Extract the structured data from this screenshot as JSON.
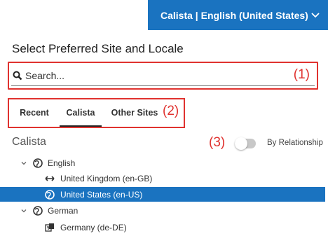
{
  "header": {
    "site_button_label": "Calista | English (United States)",
    "chevron_icon": "chevron-down-icon"
  },
  "panel": {
    "title": "Select Preferred Site and Locale",
    "search": {
      "placeholder": "Search...",
      "value": ""
    },
    "callouts": {
      "search": "(1)",
      "tabs": "(2)",
      "toggle": "(3)"
    },
    "tabs": [
      {
        "label": "Recent"
      },
      {
        "label": "Calista",
        "active": true
      },
      {
        "label": "Other Sites"
      }
    ],
    "section_title": "Calista",
    "toggle": {
      "label": "By Relationship",
      "on": false
    },
    "tree": [
      {
        "label": "English",
        "icon": "globe-icon",
        "expanded": true
      },
      {
        "label": "United Kingdom (en-GB)",
        "icon": "bidirectional-arrow-icon"
      },
      {
        "label": "United States (en-US)",
        "icon": "globe-icon",
        "selected": true
      },
      {
        "label": "German",
        "icon": "globe-icon",
        "expanded": true
      },
      {
        "label": "Germany (de-DE)",
        "icon": "translation-icon"
      }
    ]
  },
  "colors": {
    "accent": "#1a73c0",
    "annotation": "#e0322f"
  }
}
